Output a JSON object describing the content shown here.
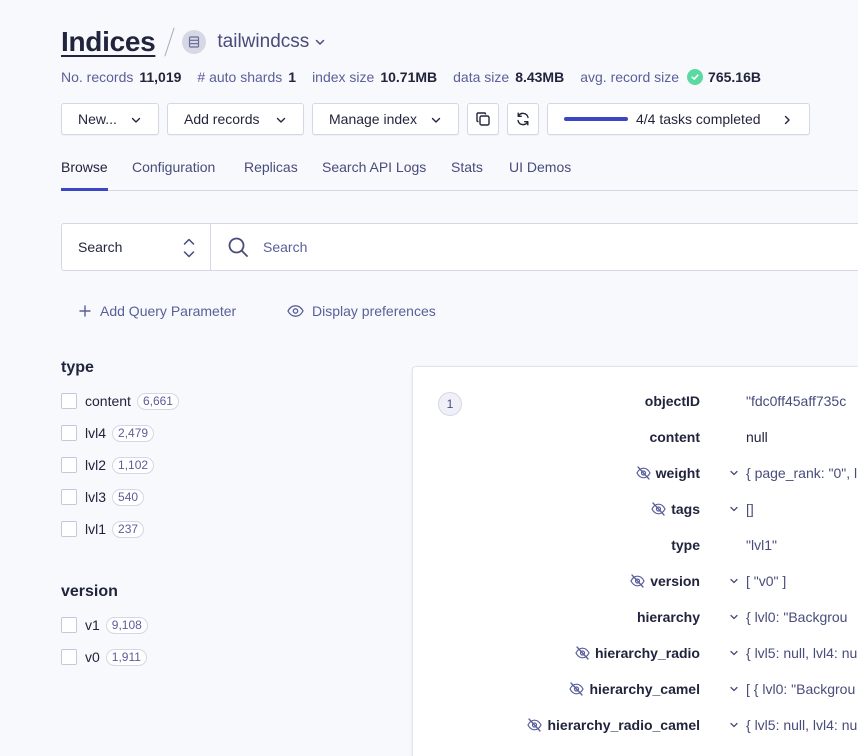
{
  "header": {
    "title": "Indices",
    "index_name": "tailwindcss"
  },
  "stats": [
    {
      "label": "No. records",
      "value": "11,019"
    },
    {
      "label": "# auto shards",
      "value": "1"
    },
    {
      "label": "index size",
      "value": "10.71MB"
    },
    {
      "label": "data size",
      "value": "8.43MB"
    },
    {
      "label": "avg. record size",
      "value": "765.16B"
    }
  ],
  "toolbar": {
    "new_label": "New...",
    "add_records_label": "Add records",
    "manage_index_label": "Manage index",
    "tasks_label": "4/4 tasks completed",
    "tasks_progress": 1.0
  },
  "tabs": [
    "Browse",
    "Configuration",
    "Replicas",
    "Search API Logs",
    "Stats",
    "UI Demos"
  ],
  "active_tab": "Browse",
  "search": {
    "mode_label": "Search",
    "placeholder": "Search"
  },
  "links": {
    "add_query": "Add Query Parameter",
    "display_prefs": "Display preferences"
  },
  "facets": {
    "type": {
      "title": "type",
      "items": [
        {
          "label": "content",
          "count": "6,661"
        },
        {
          "label": "lvl4",
          "count": "2,479"
        },
        {
          "label": "lvl2",
          "count": "1,102"
        },
        {
          "label": "lvl3",
          "count": "540"
        },
        {
          "label": "lvl1",
          "count": "237"
        }
      ]
    },
    "version": {
      "title": "version",
      "items": [
        {
          "label": "v1",
          "count": "9,108"
        },
        {
          "label": "v0",
          "count": "1,911"
        }
      ]
    }
  },
  "hit": {
    "number": "1",
    "attributes": [
      {
        "key": "objectID",
        "value": "\"fdc0ff45aff735c"
      },
      {
        "key": "content",
        "value": "null"
      },
      {
        "key": "weight",
        "value": "{ page_rank: \"0\", l"
      },
      {
        "key": "tags",
        "value": "[]"
      },
      {
        "key": "type",
        "value": "\"lvl1\""
      },
      {
        "key": "version",
        "value": "[ \"v0\" ]"
      },
      {
        "key": "hierarchy",
        "value": "{ lvl0: \"Backgrou"
      },
      {
        "key": "hierarchy_radio",
        "value": "{ lvl5: null, lvl4: nu"
      },
      {
        "key": "hierarchy_camel",
        "value": "[ { lvl0: \"Backgrou"
      },
      {
        "key": "hierarchy_radio_camel",
        "value": "{ lvl5: null, lvl4: nu"
      }
    ]
  },
  "colors": {
    "accent": "#3a46c4",
    "ok": "#5adaa1",
    "text": "#21243d",
    "muted": "#5a5e9a"
  }
}
